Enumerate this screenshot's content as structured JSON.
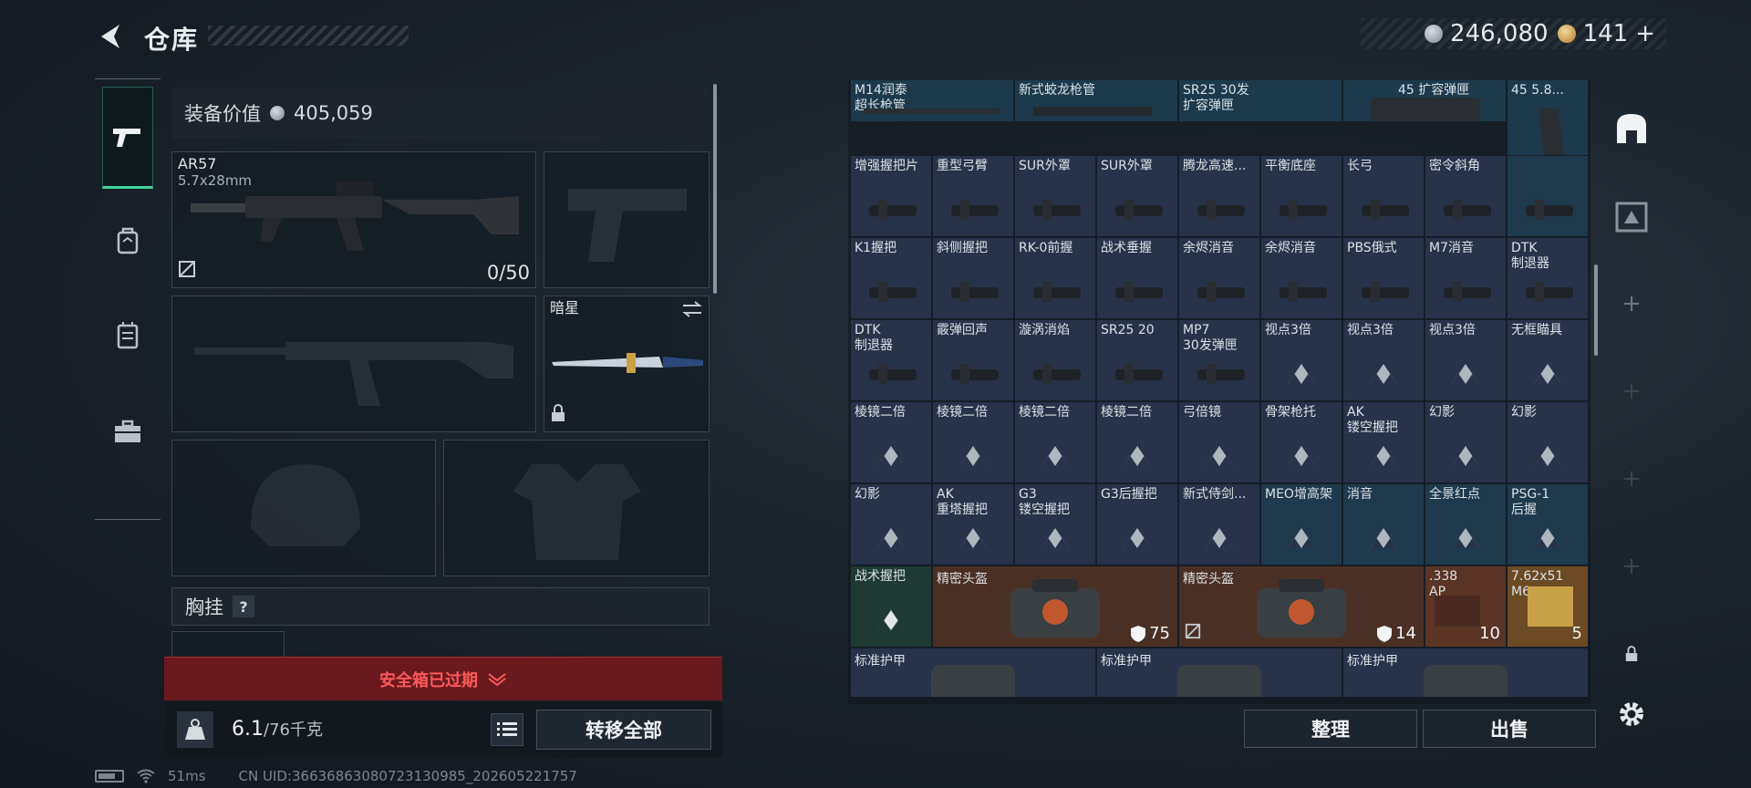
{
  "header": {
    "title": "仓库"
  },
  "currency": [
    {
      "icon": "silver-coin-icon",
      "value": "246,080"
    },
    {
      "icon": "gold-coin-icon",
      "value": "141",
      "plus": "+"
    }
  ],
  "sidebar": [
    {
      "icon": "pistol-icon",
      "active": true
    },
    {
      "icon": "backpack-icon"
    },
    {
      "icon": "vest-icon"
    },
    {
      "icon": "briefcase-icon"
    }
  ],
  "equipment": {
    "value_label": "装备价值",
    "value": "405,059",
    "primary_weapon": {
      "name": "AR57",
      "caliber": "5.7x28mm",
      "ammo": "0/50"
    },
    "melee": {
      "name": "暗星"
    },
    "vest_label": "胸挂",
    "vest_help": "?"
  },
  "safe_box": {
    "status": "安全箱已过期"
  },
  "weight": {
    "current": "6.1",
    "max": "/76千克"
  },
  "buttons": {
    "transfer_all": "转移全部",
    "sort": "整理",
    "sell": "出售"
  },
  "status_bar": {
    "ping": "51ms",
    "uid": "CN UID:36636863080723130985_202605221757"
  },
  "inventory": {
    "row0": [
      "M14润泰\n超长枪管",
      "新式蛟龙枪管",
      "SR25 30发\n扩容弹匣",
      "",
      "45 扩容弹匣",
      "",
      "45 5.8..."
    ],
    "rows": [
      [
        {
          "name": "增强握把片"
        },
        {
          "name": "重型弓臂"
        },
        {
          "name": "SUR外罩"
        },
        {
          "name": "SUR外罩"
        },
        {
          "name": "腾龙高速..."
        },
        {
          "name": "平衡底座"
        },
        {
          "name": "长弓"
        },
        {
          "name": "密令斜角"
        },
        {
          "name": ""
        }
      ],
      [
        {
          "name": "K1握把"
        },
        {
          "name": "斜侧握把"
        },
        {
          "name": "RK-0前握"
        },
        {
          "name": "战术垂握"
        },
        {
          "name": "余烬消音"
        },
        {
          "name": "余烬消音"
        },
        {
          "name": "PBS俄式"
        },
        {
          "name": "M7消音"
        },
        {
          "name": "DTK\n制退器"
        }
      ],
      [
        {
          "name": "DTK\n制退器"
        },
        {
          "name": "霰弹回声"
        },
        {
          "name": "漩涡消焰"
        },
        {
          "name": "SR25 20"
        },
        {
          "name": "MP7\n30发弹匣"
        },
        {
          "name": "视点3倍"
        },
        {
          "name": "视点3倍"
        },
        {
          "name": "视点3倍"
        },
        {
          "name": "无框瞄具"
        }
      ],
      [
        {
          "name": "棱镜二倍"
        },
        {
          "name": "棱镜二倍"
        },
        {
          "name": "棱镜二倍"
        },
        {
          "name": "棱镜二倍"
        },
        {
          "name": "弓倍镜"
        },
        {
          "name": "骨架枪托"
        },
        {
          "name": "AK\n镂空握把"
        },
        {
          "name": "幻影"
        },
        {
          "name": "幻影"
        }
      ],
      [
        {
          "name": "幻影"
        },
        {
          "name": "AK\n重塔握把"
        },
        {
          "name": "G3\n镂空握把"
        },
        {
          "name": "G3后握把"
        },
        {
          "name": "新式侍剑..."
        },
        {
          "name": "MEO增高架"
        },
        {
          "name": "消音"
        },
        {
          "name": "全景红点"
        },
        {
          "name": "PSG-1\n后握"
        }
      ]
    ],
    "row6": {
      "tactical_grip": "战术握把",
      "helmet_a": {
        "name": "精密头盔",
        "armor": "75"
      },
      "helmet_b": {
        "name": "精密头盔",
        "armor": "14"
      },
      "ammo_a": {
        "name": ".338\nAP",
        "qty": "10"
      },
      "ammo_b": {
        "name": "7.62x51\nM6...",
        "qty": "5"
      }
    },
    "row7": [
      "标准护甲",
      "标准护甲",
      "标准护甲"
    ]
  }
}
